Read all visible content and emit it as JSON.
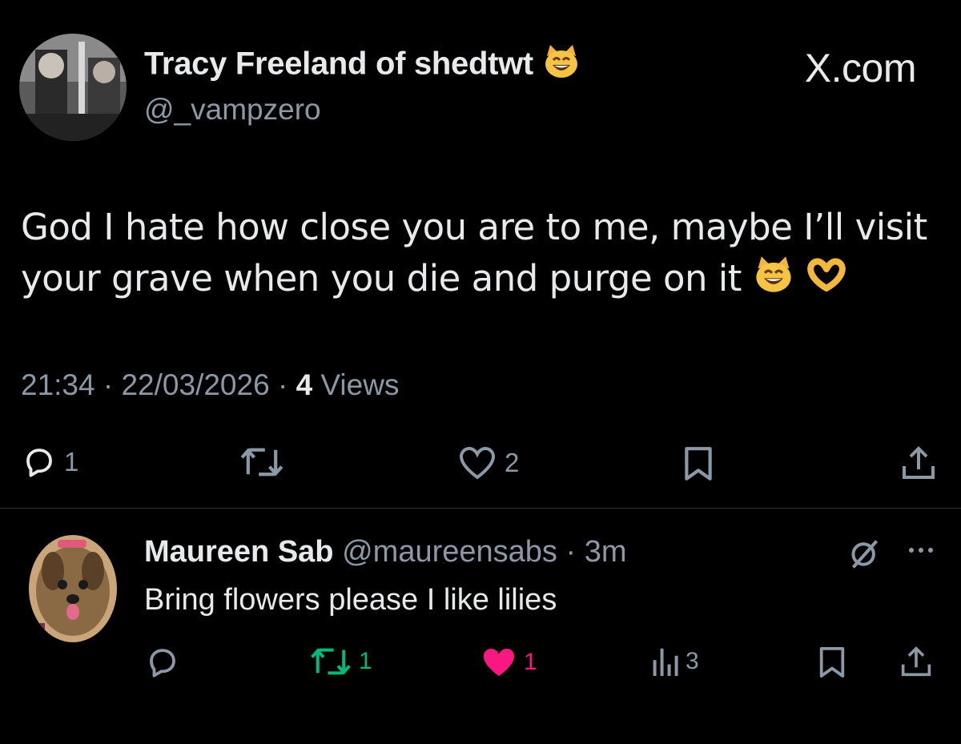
{
  "tweet": {
    "author_name": "Tracy Freeland of shedtwt",
    "author_handle": "@_vampzero",
    "brand": "X.com",
    "text_line1": "God I hate how close you are to me, maybe I’ll visit",
    "text_line2": "your grave when you die and purge on it",
    "time": "21:34",
    "date": "22/03/2026",
    "views_count": "4",
    "views_label": "Views",
    "separator": "·",
    "replies": "1",
    "likes": "2",
    "name_emoji_icon": "grinning-cat-emoji",
    "text_emoji_icons": [
      "grinning-cat-emoji",
      "heart-hands-emoji"
    ]
  },
  "reply": {
    "author_name": "Maureen Sab",
    "author_handle": "@maureensabs",
    "separator": "·",
    "time": "3m",
    "text": "Bring flowers please I like lilies",
    "retweets": "1",
    "likes": "1",
    "views": "3"
  },
  "colors": {
    "background": "#000000",
    "text_primary": "#e7e9ea",
    "text_secondary": "#8b98a5",
    "retweet_green": "#00ba7c",
    "like_pink": "#f91880",
    "divider": "#2f3336"
  }
}
